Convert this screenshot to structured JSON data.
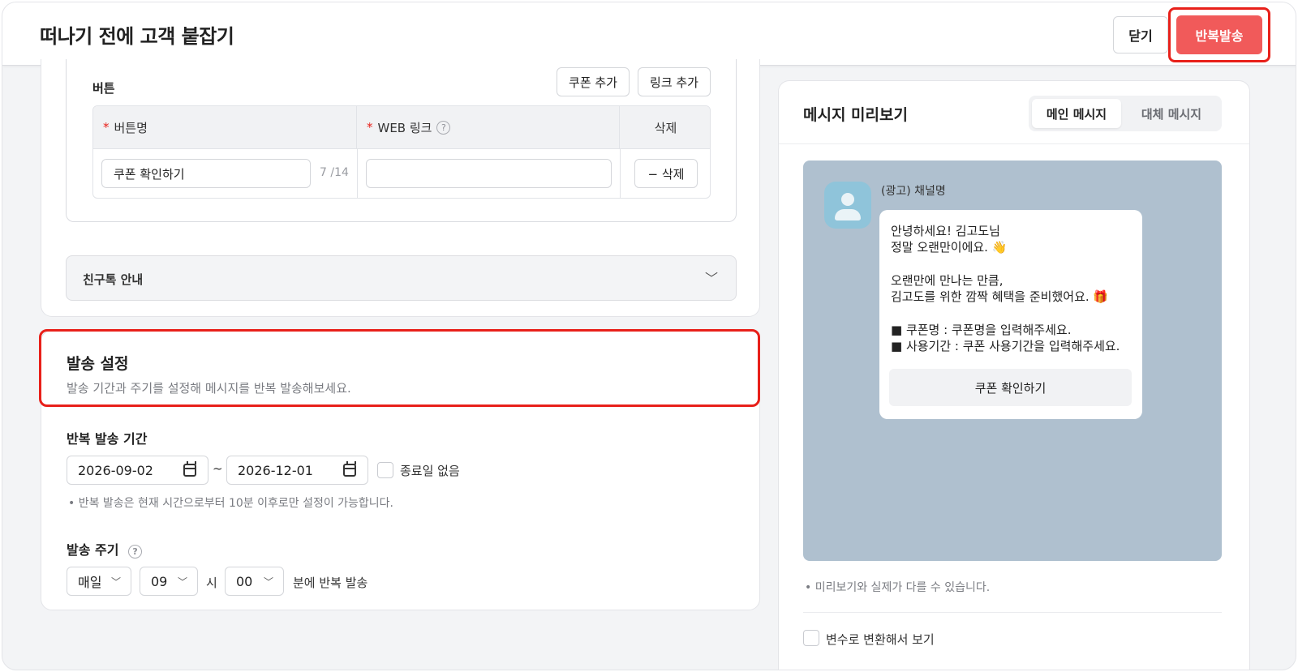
{
  "header": {
    "title": "떠나기 전에 고객 붙잡기",
    "close_label": "닫기",
    "send_label": "반복발송"
  },
  "buttons_section": {
    "label": "버튼",
    "add_coupon_label": "쿠폰 추가",
    "add_link_label": "링크 추가",
    "columns": [
      "버튼명",
      "WEB 링크",
      "삭제"
    ],
    "required_mark": "*",
    "help_mark": "?",
    "row": {
      "button_name": "쿠폰 확인하기",
      "counter": "7 /14",
      "web_link": "",
      "delete_label": "− 삭제"
    }
  },
  "friendtalk": {
    "title": "친구톡 안내",
    "chevron": "﹀"
  },
  "send_settings": {
    "title": "발송 설정",
    "description": "발송 기간과 주기를 설정해 메시지를 반복 발송해보세요.",
    "period_label": "반복 발송 기간",
    "start_date": "2026-09-02",
    "separator": "~",
    "end_date": "2026-12-01",
    "no_end_label": "종료일 없음",
    "note": "•  반복 발송은 현재 시간으로부터 10분 이후로만 설정이 가능합니다.",
    "cycle_label": "발송 주기",
    "cycle_help": "?",
    "frequency": "매일",
    "hour": "09",
    "hour_unit": "시",
    "minute": "00",
    "minute_suffix": "분에 반복 발송",
    "select_chevron": "﹀"
  },
  "preview": {
    "title": "메시지 미리보기",
    "tab_main": "메인 메시지",
    "tab_alt": "대체 메시지",
    "channel_name": "(광고) 채널명",
    "message_lines": [
      "안녕하세요! 김고도님",
      "정말 오랜만이에요. 👋",
      "오랜만에 만나는 만큼,",
      "김고도를 위한 깜짝 혜택을 준비했어요. 🎁",
      "■ 쿠폰명 : 쿠폰명을 입력해주세요.",
      "■ 사용기간 : 쿠폰 사용기간을 입력해주세요."
    ],
    "bubble_button": "쿠폰 확인하기",
    "note": "•  미리보기와 실제가 다를 수 있습니다.",
    "variable_toggle_label": "변수로 변환해서 보기"
  },
  "colors": {
    "accent_red": "#f15a5a",
    "highlight_red": "#e8201a",
    "preview_bg": "#afc0cf"
  },
  "icons": [
    "calendar-icon",
    "chevron-down-icon",
    "help-icon",
    "avatar-icon"
  ]
}
